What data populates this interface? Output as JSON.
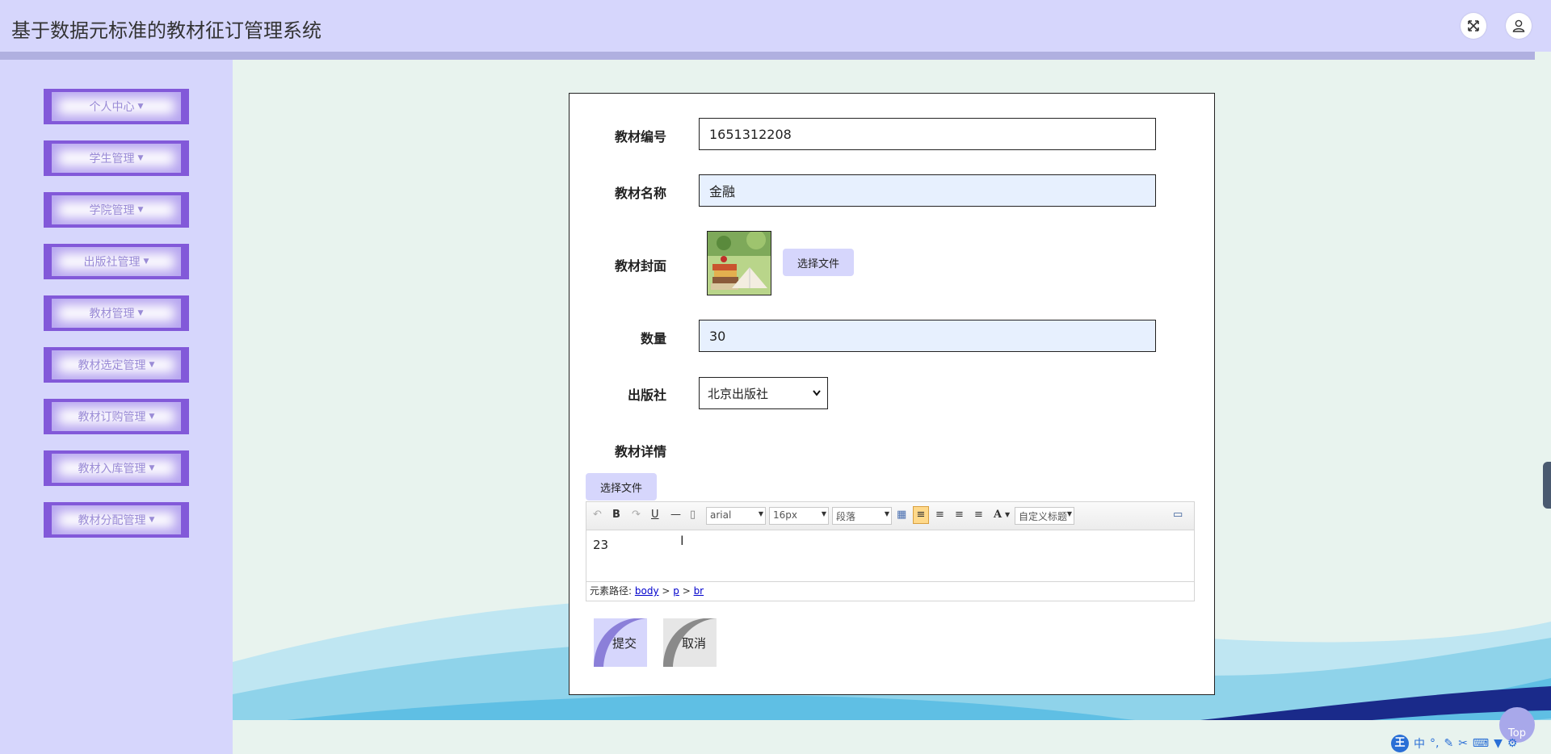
{
  "app": {
    "title": "基于数据元标准的教材征订管理系统",
    "icons": [
      "fullscreen-icon",
      "user-icon"
    ]
  },
  "sidebar": {
    "items": [
      {
        "label": "个人中心"
      },
      {
        "label": "学生管理"
      },
      {
        "label": "学院管理"
      },
      {
        "label": "出版社管理"
      },
      {
        "label": "教材管理"
      },
      {
        "label": "教材选定管理"
      },
      {
        "label": "教材订购管理"
      },
      {
        "label": "教材入库管理"
      },
      {
        "label": "教材分配管理"
      }
    ]
  },
  "form": {
    "code": {
      "label": "教材编号",
      "value": "1651312208"
    },
    "name": {
      "label": "教材名称",
      "value": "金融"
    },
    "cover": {
      "label": "教材封面",
      "button": "选择文件"
    },
    "quantity": {
      "label": "数量",
      "value": "30"
    },
    "publisher": {
      "label": "出版社",
      "value": "北京出版社"
    },
    "details": {
      "label": "教材详情",
      "button": "选择文件"
    }
  },
  "editor": {
    "font": "arial",
    "size": "16px",
    "paragraph": "段落",
    "custom_title": "自定义标题",
    "content": "23",
    "path_label": "元素路径:",
    "path": [
      "body",
      "p",
      "br"
    ]
  },
  "actions": {
    "submit": "提交",
    "cancel": "取消"
  },
  "misc": {
    "top": "Top",
    "ime": "中"
  },
  "colors": {
    "header": "#d6d6fc",
    "sidebar_accent": "#8259d9",
    "field_bg": "#e7f0fe"
  }
}
